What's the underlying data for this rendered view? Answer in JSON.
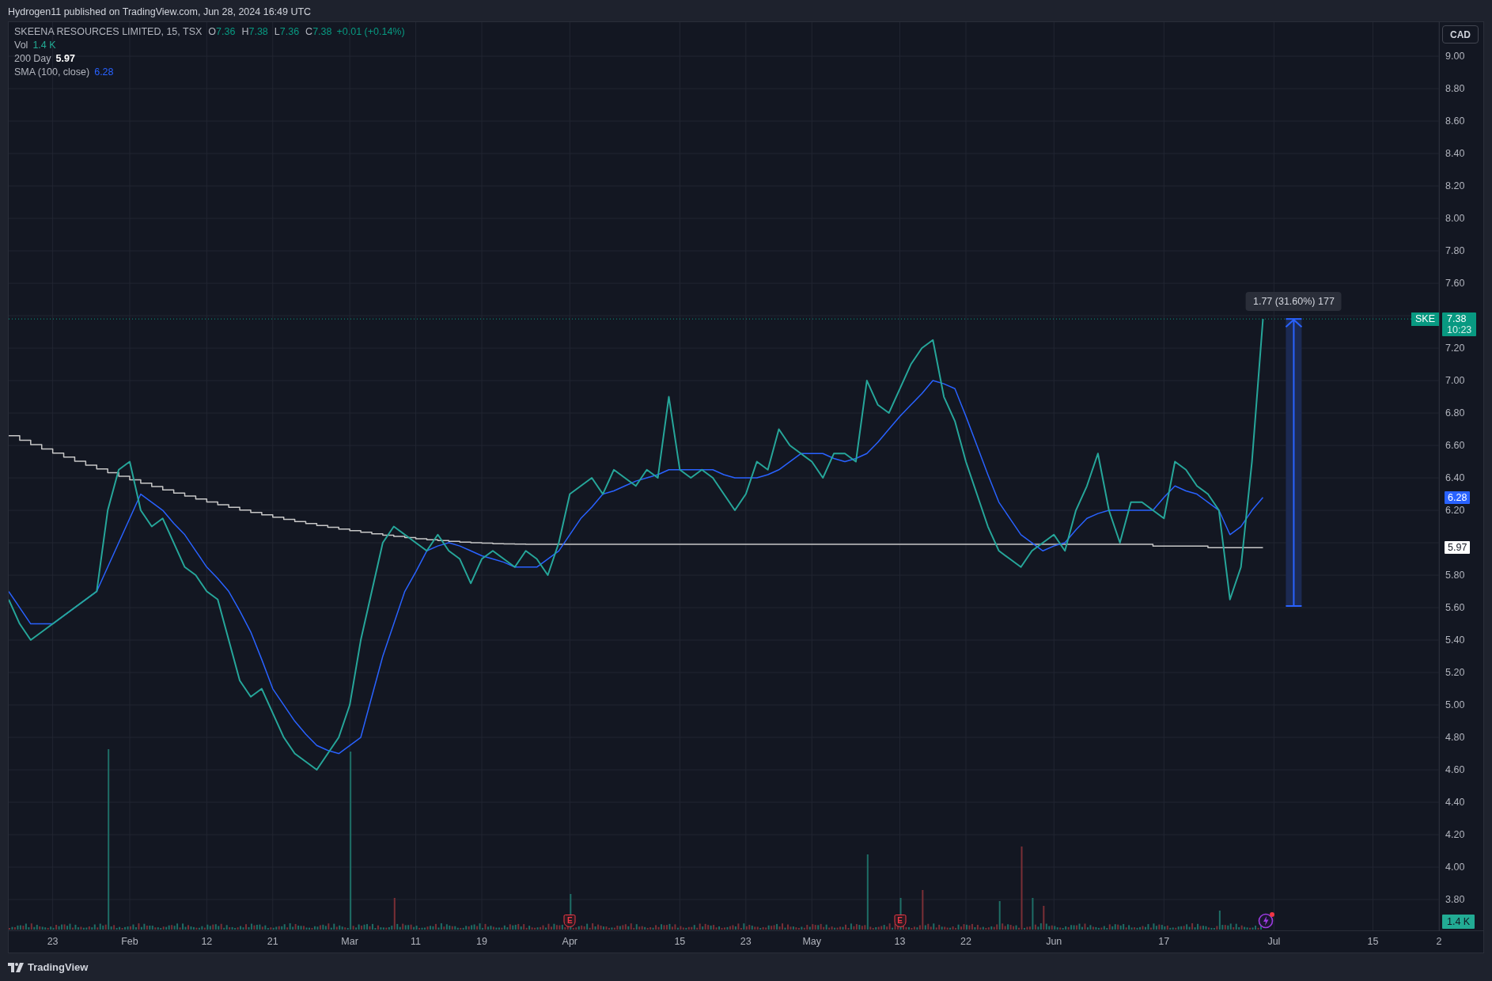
{
  "caption": "Hydrogen11 published on TradingView.com, Jun 28, 2024 16:49 UTC",
  "legend": {
    "title": "SKEENA RESOURCES LIMITED, 15, TSX",
    "ohlc": [
      {
        "label": "O",
        "value": "7.36"
      },
      {
        "label": "H",
        "value": "7.38"
      },
      {
        "label": "L",
        "value": "7.36"
      },
      {
        "label": "C",
        "value": "7.38"
      }
    ],
    "change": "+0.01 (+0.14%)",
    "indicators": [
      {
        "name": "Vol",
        "value": "1.4 K",
        "color": "#22ab94"
      },
      {
        "name": "200 Day",
        "value": "5.97",
        "color": "#ffffff"
      },
      {
        "name": "SMA (100, close)",
        "value": "6.28",
        "color": "#2962ff"
      }
    ]
  },
  "chart": {
    "measure": "1.77 (31.60%) 177",
    "events": [
      {
        "kind": "earnings",
        "label": "E"
      },
      {
        "kind": "earnings",
        "label": "E"
      },
      {
        "kind": "news"
      }
    ],
    "currency": "CAD",
    "price_labels": [
      "9.00",
      "8.80",
      "8.60",
      "8.40",
      "8.20",
      "8.00",
      "7.80",
      "7.60",
      "7.20",
      "7.00",
      "6.80",
      "6.60",
      "6.40",
      "6.20",
      "5.80",
      "5.60",
      "5.40",
      "5.20",
      "5.00",
      "4.80",
      "4.60",
      "4.40",
      "4.20",
      "4.00",
      "3.80"
    ],
    "badges": [
      {
        "kind": "symbol",
        "label": "SKE",
        "value": "7.38",
        "time": "10:23",
        "color": "#089981"
      },
      {
        "kind": "indicator",
        "value": "6.28",
        "color": "#2962ff"
      },
      {
        "kind": "indicator",
        "value": "5.97",
        "color": "#ffffff"
      },
      {
        "kind": "volume",
        "value": "1.4 K",
        "color": "#22ab94"
      }
    ],
    "date_labels": [
      "23",
      "Feb",
      "12",
      "21",
      "Mar",
      "11",
      "19",
      "Apr",
      "15",
      "23",
      "May",
      "13",
      "22",
      "Jun",
      "17",
      "Jul",
      "15",
      "2"
    ]
  },
  "footer": {
    "brand": "TradingView"
  }
}
